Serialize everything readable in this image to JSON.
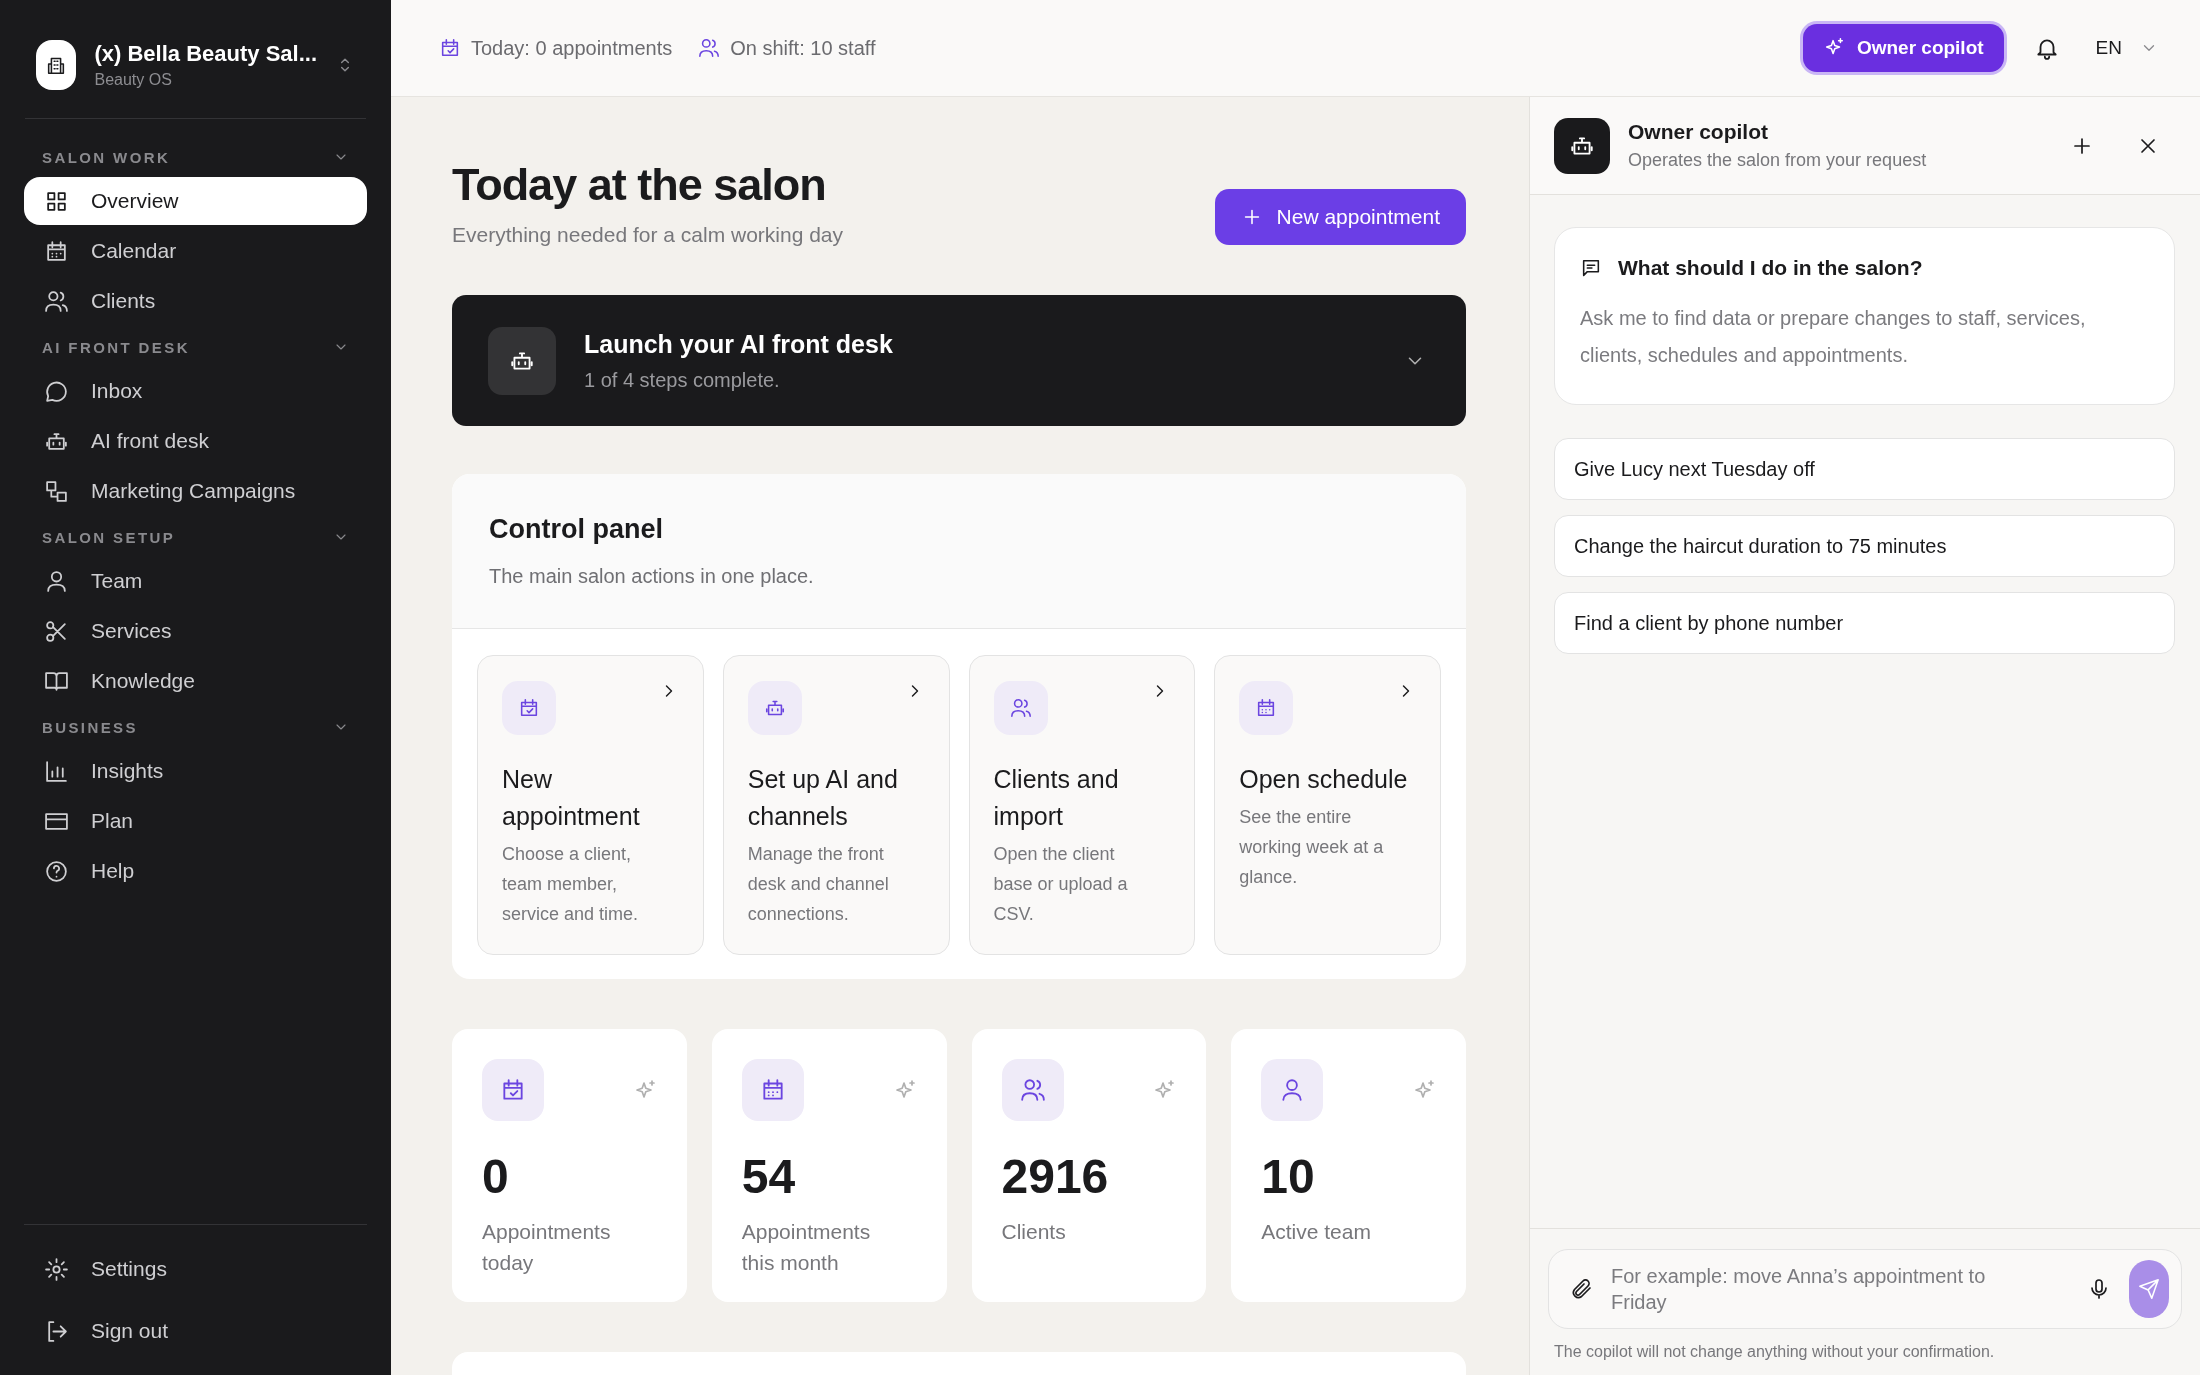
{
  "sidebar": {
    "workspace": {
      "name": "(x) Bella Beauty Sal...",
      "subtitle": "Beauty OS"
    },
    "sections": [
      {
        "title": "SALON WORK",
        "items": [
          {
            "label": "Overview",
            "selected": true
          },
          {
            "label": "Calendar",
            "selected": false
          },
          {
            "label": "Clients",
            "selected": false
          }
        ]
      },
      {
        "title": "AI FRONT DESK",
        "items": [
          {
            "label": "Inbox",
            "selected": false
          },
          {
            "label": "AI front desk",
            "selected": false
          },
          {
            "label": "Marketing Campaigns",
            "selected": false
          }
        ]
      },
      {
        "title": "SALON SETUP",
        "items": [
          {
            "label": "Team",
            "selected": false
          },
          {
            "label": "Services",
            "selected": false
          },
          {
            "label": "Knowledge",
            "selected": false
          }
        ]
      },
      {
        "title": "BUSINESS",
        "items": [
          {
            "label": "Insights",
            "selected": false
          },
          {
            "label": "Plan",
            "selected": false
          },
          {
            "label": "Help",
            "selected": false
          }
        ]
      }
    ],
    "footer_items": [
      {
        "label": "Settings"
      },
      {
        "label": "Sign out"
      }
    ]
  },
  "top_bar": {
    "stats": [
      "Today: 0 appointments",
      "On shift: 10 staff"
    ],
    "copilot_button": "Owner copilot",
    "language": "EN"
  },
  "page": {
    "title": "Today at the salon",
    "subtitle": "Everything needed for a calm working day",
    "new_button": "New appointment"
  },
  "setup_banner": {
    "title": "Launch your AI front desk",
    "progress": "1 of 4 steps complete."
  },
  "control_panel": {
    "title": "Control panel",
    "subtitle": "The main salon actions in one place.",
    "actions": [
      {
        "title": "New appointment",
        "description": "Choose a client, team member, service and time."
      },
      {
        "title": "Set up AI and channels",
        "description": "Manage the front desk and channel connections."
      },
      {
        "title": "Clients and import",
        "description": "Open the client base or upload a CSV."
      },
      {
        "title": "Open schedule",
        "description": "See the entire working week at a glance."
      }
    ]
  },
  "metrics": [
    {
      "value": "0",
      "label": "Appointments today"
    },
    {
      "value": "54",
      "label": "Appointments this month"
    },
    {
      "value": "2916",
      "label": "Clients"
    },
    {
      "value": "10",
      "label": "Active team"
    }
  ],
  "copilot": {
    "title": "Owner copilot",
    "subtitle": "Operates the salon from your request",
    "intro": {
      "title": "What should I do in the salon?",
      "text": "Ask me to find data or prepare changes to staff, services, clients, schedules and appointments."
    },
    "suggestions": [
      "Give Lucy next Tuesday off",
      "Change the haircut duration to 75 minutes",
      "Find a client by phone number"
    ],
    "input": {
      "placeholder": "For example: move Anna’s appointment to Friday"
    },
    "disclaimer": "The copilot will not change anything without your confirmation."
  }
}
